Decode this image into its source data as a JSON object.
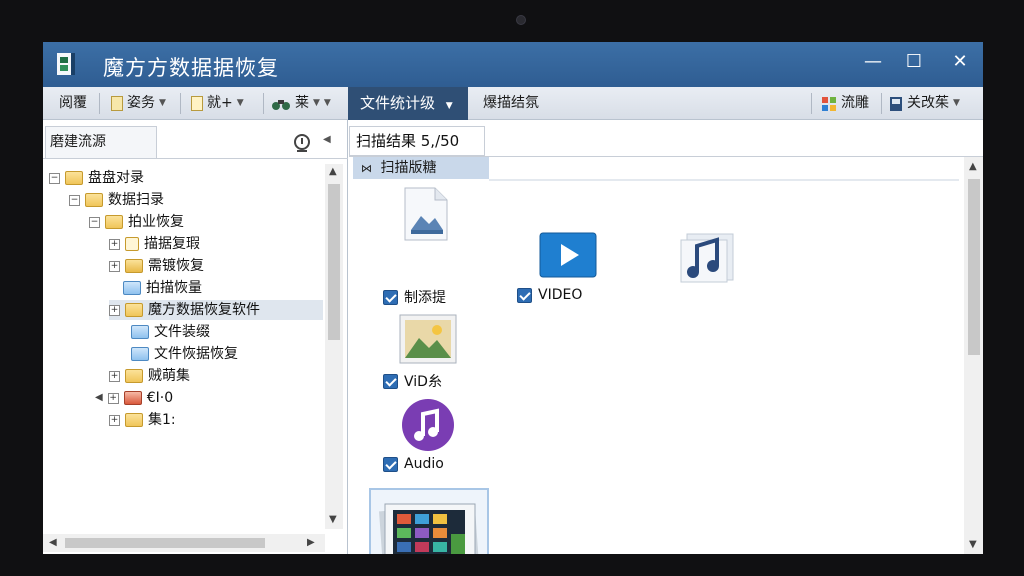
{
  "window": {
    "title": "魔方方数据据恢复",
    "controls": {
      "minimize": "—",
      "maximize": "☐",
      "close": "✕"
    }
  },
  "toolbar": {
    "items": [
      {
        "label": "阅覆",
        "icon": "none"
      },
      {
        "label": "姿务",
        "icon": "page-icon"
      },
      {
        "label": "就+",
        "icon": "document-icon"
      },
      {
        "label": "莱",
        "icon": "binoculars-icon"
      },
      {
        "label": "文件统计级",
        "icon": "none"
      },
      {
        "label": "爆描结氛",
        "icon": "none"
      },
      {
        "label": "流雕",
        "icon": "windows-icon"
      },
      {
        "label": "关改茱",
        "icon": "disk-icon"
      }
    ]
  },
  "left_pane": {
    "tab_label": "磨建流源",
    "tree": [
      {
        "label": "盘盘对录",
        "level": 0,
        "expander": "⊟",
        "folder": "yellow"
      },
      {
        "label": "数据扫录",
        "level": 1,
        "expander": "⊟",
        "folder": "yellow"
      },
      {
        "label": "拍业恢复",
        "level": 2,
        "expander": "⊟",
        "folder": "yellow"
      },
      {
        "label": "描据复瑕",
        "level": 3,
        "expander": "⊞",
        "folder": "doc"
      },
      {
        "label": "需镀恢复",
        "level": 3,
        "expander": "⊞",
        "folder": "img"
      },
      {
        "label": "拍描恢量",
        "level": 3,
        "expander": "",
        "folder": "blue"
      },
      {
        "label": "魔方数据恢复软件",
        "level": 3,
        "expander": "⊞",
        "folder": "yellow",
        "selected": true
      },
      {
        "label": "文件装缀",
        "level": 4,
        "expander": "",
        "folder": "blue"
      },
      {
        "label": "文件恢据恢复",
        "level": 4,
        "expander": "",
        "folder": "blue"
      },
      {
        "label": "贼萌集",
        "level": 3,
        "expander": "⊞",
        "folder": "yellow"
      },
      {
        "label": "€I·0",
        "level": 3,
        "expander": "⊞",
        "folder": "red"
      },
      {
        "label": "集1:",
        "level": 3,
        "expander": "⊞",
        "folder": "yellow"
      }
    ]
  },
  "right_pane": {
    "results_tab": "扫描结果  5,/50",
    "group_header": "扫描版糖",
    "items": [
      {
        "caption": "制添提",
        "checked": true,
        "icon": "image-file-icon"
      },
      {
        "caption": "VIDEO",
        "checked": true,
        "icon": "video-play-icon"
      },
      {
        "caption": "",
        "checked": false,
        "icon": "music-note-icon"
      },
      {
        "caption": "ViD糸",
        "checked": true,
        "icon": "landscape-image-icon"
      },
      {
        "caption": "Audio",
        "checked": true,
        "icon": "audio-note-icon"
      },
      {
        "caption": "",
        "checked": false,
        "icon": "photo-gallery-icon"
      }
    ]
  },
  "colors": {
    "titlebar": "#3c6fa6",
    "toolbar_active": "#2f4f75",
    "group_header": "#c9d8ea",
    "checkbox": "#2e6db4"
  }
}
